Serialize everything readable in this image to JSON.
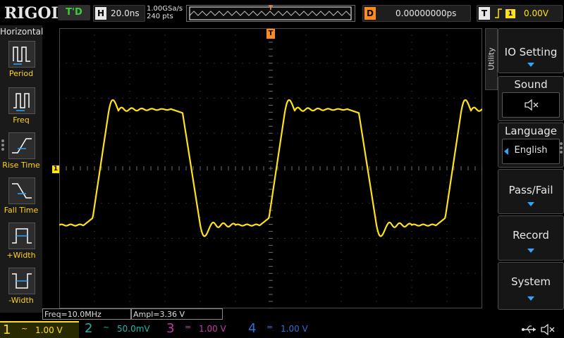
{
  "top": {
    "brand": "RIGOL",
    "run_status": "T'D",
    "horizontal_key": "H",
    "timebase": "20.0ns",
    "sample_rate": "1.00GSa/s",
    "memory_depth": "240 pts",
    "delay_key": "D",
    "delay_value": "0.00000000ps",
    "trigger_key": "T",
    "trigger_edge_icon": "rising-edge-icon",
    "trigger_source": "1",
    "trigger_level": "0.00V",
    "trigger_marker": "T"
  },
  "left_menu": {
    "title": "Horizontal",
    "items": [
      {
        "label": "Period",
        "icon": "period-icon"
      },
      {
        "label": "Freq",
        "icon": "frequency-icon"
      },
      {
        "label": "Rise Time",
        "icon": "rise-time-icon"
      },
      {
        "label": "Fall Time",
        "icon": "fall-time-icon"
      },
      {
        "label": "+Width",
        "icon": "positive-width-icon"
      },
      {
        "label": "-Width",
        "icon": "negative-width-icon"
      }
    ]
  },
  "right_menu": {
    "tab": "Utility",
    "io_setting": "IO Setting",
    "sound": "Sound",
    "language": "Language",
    "language_value": "English",
    "pass_fail": "Pass/Fail",
    "record": "Record",
    "system": "System"
  },
  "markers": {
    "ch1_ground": "1"
  },
  "measurements": {
    "freq": "Freq=10.0MHz",
    "ampl": "Ampl=3.36 V"
  },
  "channels": [
    {
      "num": "1",
      "coupling": "~",
      "scale": "1.00 V",
      "color": "#ffe11a",
      "active": true
    },
    {
      "num": "2",
      "coupling": "~",
      "scale": "50.0mV",
      "color": "#1fb5a7",
      "active": false
    },
    {
      "num": "3",
      "coupling": "=",
      "scale": "1.00 V",
      "color": "#c43aa8",
      "active": false
    },
    {
      "num": "4",
      "coupling": "=",
      "scale": "1.00 V",
      "color": "#2f6fd6",
      "active": false
    }
  ],
  "colors": {
    "trace": "#ffe11a",
    "trigger": "#ff8c1a",
    "accent": "#2aa7ff"
  },
  "chart_data": {
    "type": "line",
    "title": "",
    "xlabel": "",
    "ylabel": "",
    "x_unit_per_div": "20.0ns",
    "y_unit_per_div": "1.00 V",
    "series": [
      {
        "values_description_none": "",
        "x": [
          -120,
          -106,
          -101,
          -92,
          -64,
          -55,
          -46,
          -16,
          0,
          14,
          34,
          44,
          80,
          94,
          99,
          108,
          136,
          145,
          154,
          184,
          200,
          214,
          234,
          244,
          280,
          294,
          299,
          308,
          336,
          345,
          354,
          384,
          400
        ],
        "y": [
          -1.62,
          -1.62,
          -1.42,
          1.6,
          1.7,
          1.68,
          1.68,
          1.68,
          -1.55,
          -1.7,
          -1.62,
          -1.66,
          -1.62,
          -1.62,
          -1.42,
          1.6,
          1.7,
          1.68,
          1.68,
          1.68,
          -1.55,
          -1.7,
          -1.62,
          -1.66,
          -1.62,
          -1.62,
          -1.42,
          1.6,
          1.7,
          1.68,
          1.68,
          1.68,
          -1.55
        ]
      }
    ]
  }
}
